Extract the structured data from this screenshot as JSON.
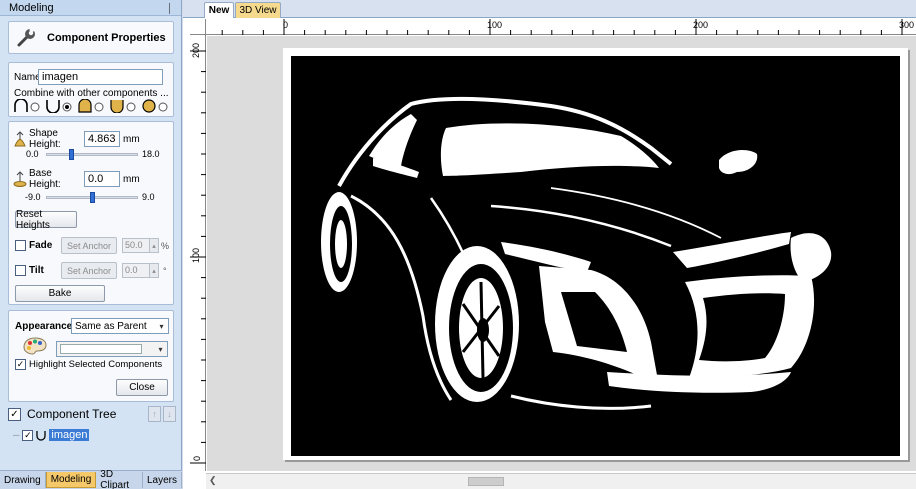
{
  "panel": {
    "title": "Modeling",
    "pin_icon": "pin-icon",
    "component_properties_title": "Component Properties",
    "name_label": "Name",
    "name_value": "imagen",
    "combine_label": "Combine with other components ...",
    "combine_modes": [
      "add",
      "subtract",
      "merge-high",
      "merge-low",
      "multiply"
    ],
    "combine_selected": "subtract",
    "shape_height_label": "Shape Height:",
    "shape_height_value": "4.863",
    "shape_height_unit": "mm",
    "shape_height_min": "0.0",
    "shape_height_max": "18.0",
    "shape_height_level": 0.27,
    "base_height_label": "Base Height:",
    "base_height_value": "0.0",
    "base_height_unit": "mm",
    "base_height_min": "-9.0",
    "base_height_max": "9.0",
    "base_height_level": 0.5,
    "reset_heights": "Reset Heights",
    "fade_label": "Fade",
    "fade_checked": false,
    "fade_set_anchor": "Set Anchor",
    "fade_value": "50.0",
    "fade_unit": "%",
    "tilt_label": "Tilt",
    "tilt_checked": false,
    "tilt_set_anchor": "Set Anchor",
    "tilt_value": "0.0",
    "tilt_unit": "°",
    "bake": "Bake",
    "appearance_label": "Appearance",
    "appearance_value": "Same as Parent",
    "material_value": "",
    "highlight_label": "Highlight Selected Components",
    "highlight_checked": true,
    "close": "Close"
  },
  "tree": {
    "title": "Component Tree",
    "checked": true,
    "item_label": "imagen",
    "item_checked": true
  },
  "bottom_tabs": [
    {
      "label": "Drawing",
      "active": false
    },
    {
      "label": "Modeling",
      "active": true
    },
    {
      "label": "3D Clipart",
      "active": false
    },
    {
      "label": "Layers",
      "active": false
    }
  ],
  "doc_tabs": [
    {
      "label": "New",
      "active": true
    },
    {
      "label": "3D View",
      "active": false
    }
  ],
  "ruler": {
    "h_labels": [
      "0",
      "100",
      "200",
      "300"
    ],
    "v_labels": [
      "200",
      "100",
      "0"
    ]
  },
  "colors": {
    "accent_tab": "#f5c96a",
    "selection": "#3a7bd5",
    "slider": "#2f6fd6"
  }
}
